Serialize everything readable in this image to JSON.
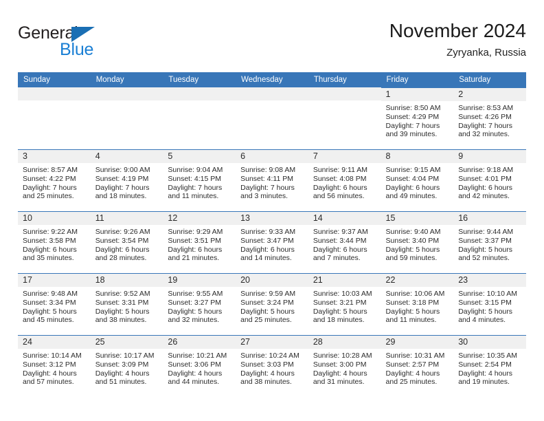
{
  "brand": {
    "word1": "General",
    "word2": "Blue",
    "triangle_color": "#1a6fb4",
    "blue_text_color": "#1a7fd4"
  },
  "header": {
    "title": "November 2024",
    "location": "Zyryanka, Russia"
  },
  "colors": {
    "header_row": "#3876b8",
    "daynum_band": "#f0f0f0",
    "cell_top_border": "#3876b8",
    "text": "#2b2b2b"
  },
  "weekdays": [
    "Sunday",
    "Monday",
    "Tuesday",
    "Wednesday",
    "Thursday",
    "Friday",
    "Saturday"
  ],
  "weeks": [
    [
      {
        "day": "",
        "blank": true
      },
      {
        "day": "",
        "blank": true
      },
      {
        "day": "",
        "blank": true
      },
      {
        "day": "",
        "blank": true
      },
      {
        "day": "",
        "blank": true
      },
      {
        "day": "1",
        "sunrise": "Sunrise: 8:50 AM",
        "sunset": "Sunset: 4:29 PM",
        "daylight1": "Daylight: 7 hours",
        "daylight2": "and 39 minutes."
      },
      {
        "day": "2",
        "sunrise": "Sunrise: 8:53 AM",
        "sunset": "Sunset: 4:26 PM",
        "daylight1": "Daylight: 7 hours",
        "daylight2": "and 32 minutes."
      }
    ],
    [
      {
        "day": "3",
        "sunrise": "Sunrise: 8:57 AM",
        "sunset": "Sunset: 4:22 PM",
        "daylight1": "Daylight: 7 hours",
        "daylight2": "and 25 minutes."
      },
      {
        "day": "4",
        "sunrise": "Sunrise: 9:00 AM",
        "sunset": "Sunset: 4:19 PM",
        "daylight1": "Daylight: 7 hours",
        "daylight2": "and 18 minutes."
      },
      {
        "day": "5",
        "sunrise": "Sunrise: 9:04 AM",
        "sunset": "Sunset: 4:15 PM",
        "daylight1": "Daylight: 7 hours",
        "daylight2": "and 11 minutes."
      },
      {
        "day": "6",
        "sunrise": "Sunrise: 9:08 AM",
        "sunset": "Sunset: 4:11 PM",
        "daylight1": "Daylight: 7 hours",
        "daylight2": "and 3 minutes."
      },
      {
        "day": "7",
        "sunrise": "Sunrise: 9:11 AM",
        "sunset": "Sunset: 4:08 PM",
        "daylight1": "Daylight: 6 hours",
        "daylight2": "and 56 minutes."
      },
      {
        "day": "8",
        "sunrise": "Sunrise: 9:15 AM",
        "sunset": "Sunset: 4:04 PM",
        "daylight1": "Daylight: 6 hours",
        "daylight2": "and 49 minutes."
      },
      {
        "day": "9",
        "sunrise": "Sunrise: 9:18 AM",
        "sunset": "Sunset: 4:01 PM",
        "daylight1": "Daylight: 6 hours",
        "daylight2": "and 42 minutes."
      }
    ],
    [
      {
        "day": "10",
        "sunrise": "Sunrise: 9:22 AM",
        "sunset": "Sunset: 3:58 PM",
        "daylight1": "Daylight: 6 hours",
        "daylight2": "and 35 minutes."
      },
      {
        "day": "11",
        "sunrise": "Sunrise: 9:26 AM",
        "sunset": "Sunset: 3:54 PM",
        "daylight1": "Daylight: 6 hours",
        "daylight2": "and 28 minutes."
      },
      {
        "day": "12",
        "sunrise": "Sunrise: 9:29 AM",
        "sunset": "Sunset: 3:51 PM",
        "daylight1": "Daylight: 6 hours",
        "daylight2": "and 21 minutes."
      },
      {
        "day": "13",
        "sunrise": "Sunrise: 9:33 AM",
        "sunset": "Sunset: 3:47 PM",
        "daylight1": "Daylight: 6 hours",
        "daylight2": "and 14 minutes."
      },
      {
        "day": "14",
        "sunrise": "Sunrise: 9:37 AM",
        "sunset": "Sunset: 3:44 PM",
        "daylight1": "Daylight: 6 hours",
        "daylight2": "and 7 minutes."
      },
      {
        "day": "15",
        "sunrise": "Sunrise: 9:40 AM",
        "sunset": "Sunset: 3:40 PM",
        "daylight1": "Daylight: 5 hours",
        "daylight2": "and 59 minutes."
      },
      {
        "day": "16",
        "sunrise": "Sunrise: 9:44 AM",
        "sunset": "Sunset: 3:37 PM",
        "daylight1": "Daylight: 5 hours",
        "daylight2": "and 52 minutes."
      }
    ],
    [
      {
        "day": "17",
        "sunrise": "Sunrise: 9:48 AM",
        "sunset": "Sunset: 3:34 PM",
        "daylight1": "Daylight: 5 hours",
        "daylight2": "and 45 minutes."
      },
      {
        "day": "18",
        "sunrise": "Sunrise: 9:52 AM",
        "sunset": "Sunset: 3:31 PM",
        "daylight1": "Daylight: 5 hours",
        "daylight2": "and 38 minutes."
      },
      {
        "day": "19",
        "sunrise": "Sunrise: 9:55 AM",
        "sunset": "Sunset: 3:27 PM",
        "daylight1": "Daylight: 5 hours",
        "daylight2": "and 32 minutes."
      },
      {
        "day": "20",
        "sunrise": "Sunrise: 9:59 AM",
        "sunset": "Sunset: 3:24 PM",
        "daylight1": "Daylight: 5 hours",
        "daylight2": "and 25 minutes."
      },
      {
        "day": "21",
        "sunrise": "Sunrise: 10:03 AM",
        "sunset": "Sunset: 3:21 PM",
        "daylight1": "Daylight: 5 hours",
        "daylight2": "and 18 minutes."
      },
      {
        "day": "22",
        "sunrise": "Sunrise: 10:06 AM",
        "sunset": "Sunset: 3:18 PM",
        "daylight1": "Daylight: 5 hours",
        "daylight2": "and 11 minutes."
      },
      {
        "day": "23",
        "sunrise": "Sunrise: 10:10 AM",
        "sunset": "Sunset: 3:15 PM",
        "daylight1": "Daylight: 5 hours",
        "daylight2": "and 4 minutes."
      }
    ],
    [
      {
        "day": "24",
        "sunrise": "Sunrise: 10:14 AM",
        "sunset": "Sunset: 3:12 PM",
        "daylight1": "Daylight: 4 hours",
        "daylight2": "and 57 minutes."
      },
      {
        "day": "25",
        "sunrise": "Sunrise: 10:17 AM",
        "sunset": "Sunset: 3:09 PM",
        "daylight1": "Daylight: 4 hours",
        "daylight2": "and 51 minutes."
      },
      {
        "day": "26",
        "sunrise": "Sunrise: 10:21 AM",
        "sunset": "Sunset: 3:06 PM",
        "daylight1": "Daylight: 4 hours",
        "daylight2": "and 44 minutes."
      },
      {
        "day": "27",
        "sunrise": "Sunrise: 10:24 AM",
        "sunset": "Sunset: 3:03 PM",
        "daylight1": "Daylight: 4 hours",
        "daylight2": "and 38 minutes."
      },
      {
        "day": "28",
        "sunrise": "Sunrise: 10:28 AM",
        "sunset": "Sunset: 3:00 PM",
        "daylight1": "Daylight: 4 hours",
        "daylight2": "and 31 minutes."
      },
      {
        "day": "29",
        "sunrise": "Sunrise: 10:31 AM",
        "sunset": "Sunset: 2:57 PM",
        "daylight1": "Daylight: 4 hours",
        "daylight2": "and 25 minutes."
      },
      {
        "day": "30",
        "sunrise": "Sunrise: 10:35 AM",
        "sunset": "Sunset: 2:54 PM",
        "daylight1": "Daylight: 4 hours",
        "daylight2": "and 19 minutes."
      }
    ]
  ]
}
